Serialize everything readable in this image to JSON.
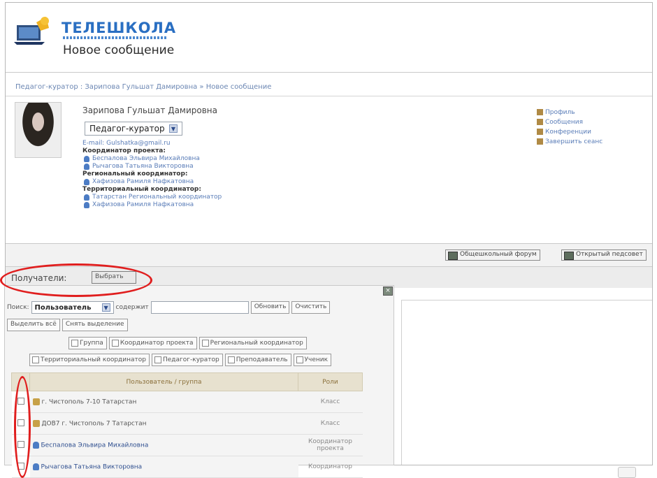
{
  "header": {
    "brand": "ТЕЛЕШКОЛА",
    "title": "Новое сообщение"
  },
  "breadcrumb": "Педагог-куратор : Зарипова Гульшат Дамировна » Новое сообщение",
  "profile": {
    "name": "Зарипова Гульшат Дамировна",
    "role": "Педагог-куратор",
    "email": "E-mail: Gulshatka@gmail.ru",
    "project_coord_label": "Координатор проекта:",
    "project_coords": [
      "Беспалова Эльвира Михайловна",
      "Рычагова Татьяна Викторовна"
    ],
    "regional_label": "Региональный координатор:",
    "regional": [
      "Хафизова Рамиля Нафкатовна"
    ],
    "territorial_label": "Территориальный координатор:",
    "territorial": [
      "Татарстан Региональный координатор",
      "Хафизова Рамиля Нафкатовна"
    ]
  },
  "side_links": [
    "Профиль",
    "Сообщения",
    "Конференции",
    "Завершить сеанс"
  ],
  "toolbar": {
    "forum": "Общешкольный форум",
    "council": "Открытый педсовет"
  },
  "recipients": {
    "label": "Получатели:",
    "choose": "Выбрать"
  },
  "search": {
    "label": "Поиск:",
    "type": "Пользователь",
    "contains": "содержит",
    "refresh": "Обновить",
    "clear": "Очистить",
    "select_all": "Выделить всё",
    "deselect": "Снять выделение"
  },
  "filters_row1": [
    "Группа",
    "Координатор проекта",
    "Региональный координатор"
  ],
  "filters_row2": [
    "Территориальный координатор",
    "Педагог-куратор",
    "Преподаватель",
    "Ученик"
  ],
  "table": {
    "col_user": "Пользователь / группа",
    "col_role": "Роли",
    "rows": [
      {
        "name": "г. Чистополь 7-10 Татарстан",
        "role": "Класс",
        "kind": "group"
      },
      {
        "name": "ДОВ7 г. Чистополь 7 Татарстан",
        "role": "Класс",
        "kind": "group"
      },
      {
        "name": "Беспалова Эльвира Михайловна",
        "role": "Координатор проекта",
        "kind": "user"
      },
      {
        "name": "Рычагова Татьяна Викторовна",
        "role": "Координатор",
        "kind": "user"
      }
    ]
  }
}
